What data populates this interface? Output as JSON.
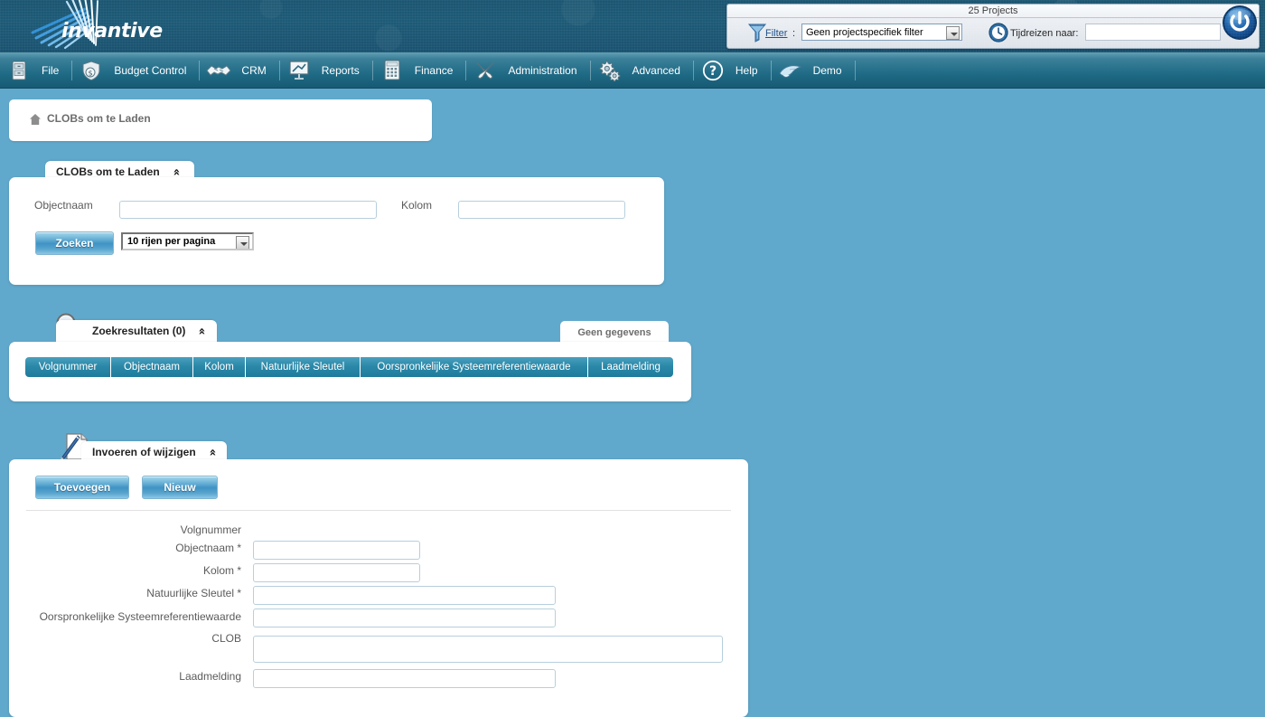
{
  "banner": {
    "logo_text": "invantive",
    "logo_icon": "invantive-fan-logo"
  },
  "filter_bar": {
    "title": "25 Projects",
    "funnel_icon": "filter-funnel-icon",
    "filter_link": "Filter",
    "colon": ":",
    "filter_value": "Geen projectspecifiek filter",
    "filter_options": [
      "Geen projectspecifiek filter"
    ],
    "clock_icon": "time-travel-clock-icon",
    "timetravel_label": "Tijdreizen naar:",
    "timetravel_value": "",
    "timetravel_placeholder": "",
    "power_icon": "power-button-icon"
  },
  "menu": {
    "items": [
      {
        "label": "File",
        "icon": "file-cabinet-icon"
      },
      {
        "label": "Budget Control",
        "icon": "money-bag-shield-icon"
      },
      {
        "label": "CRM",
        "icon": "handshake-icon"
      },
      {
        "label": "Reports",
        "icon": "presentation-chart-icon"
      },
      {
        "label": "Finance",
        "icon": "calculator-icon"
      },
      {
        "label": "Administration",
        "icon": "wrench-screwdriver-icon"
      },
      {
        "label": "Advanced",
        "icon": "gears-icon"
      },
      {
        "label": "Help",
        "icon": "question-mark-icon"
      },
      {
        "label": "Demo",
        "icon": "dolphin-icon"
      }
    ]
  },
  "breadcrumb": {
    "home_icon": "home-icon",
    "text": "CLOBs om te Laden"
  },
  "search_panel": {
    "tab_title": "CLOBs om te Laden",
    "collapse_icon": "collapse-chevron-icon",
    "fields": [
      {
        "label": "Objectnaam",
        "value": "",
        "placeholder": ""
      },
      {
        "label": "Kolom",
        "value": "",
        "placeholder": ""
      }
    ],
    "search_button": "Zoeken",
    "rows_per_page": "10 rijen per pagina",
    "rows_per_page_options": [
      "10 rijen per pagina"
    ]
  },
  "results_panel": {
    "search_icon": "magnifier-icon",
    "tab_title": "Zoekresultaten (0)",
    "collapse_icon": "collapse-chevron-icon",
    "no_data_badge": "Geen gegevens",
    "columns": [
      "Volgnummer",
      "Objectnaam",
      "Kolom",
      "Natuurlijke Sleutel",
      "Oorspronkelijke Systeemreferentiewaarde",
      "Laadmelding"
    ],
    "rows": []
  },
  "edit_panel": {
    "icon": "pencil-document-icon",
    "tab_title": "Invoeren of wijzigen",
    "collapse_icon": "collapse-chevron-icon",
    "buttons": [
      {
        "label": "Toevoegen",
        "name": "add-button"
      },
      {
        "label": "Nieuw",
        "name": "new-button"
      }
    ],
    "fields": [
      {
        "label": "Volgnummer",
        "value": "",
        "has_input": false,
        "required": false
      },
      {
        "label": "Objectnaam *",
        "value": "",
        "has_input": true,
        "required": true
      },
      {
        "label": "Kolom *",
        "value": "",
        "has_input": true,
        "required": true
      },
      {
        "label": "Natuurlijke Sleutel *",
        "value": "",
        "has_input": true,
        "required": true
      },
      {
        "label": "Oorspronkelijke Systeemreferentiewaarde",
        "value": "",
        "has_input": true,
        "required": false
      },
      {
        "label": "CLOB",
        "value": "",
        "has_input": true,
        "required": false
      },
      {
        "label": "Laadmelding",
        "value": "",
        "has_input": true,
        "required": false
      }
    ]
  },
  "colors": {
    "page_background": "#61a9cc",
    "banner_dark": "#1b5571",
    "menu_teal": "#1f6a85",
    "table_header": "#2b88a8",
    "button_blue": "#3f93c4",
    "panel_white": "#ffffff"
  }
}
